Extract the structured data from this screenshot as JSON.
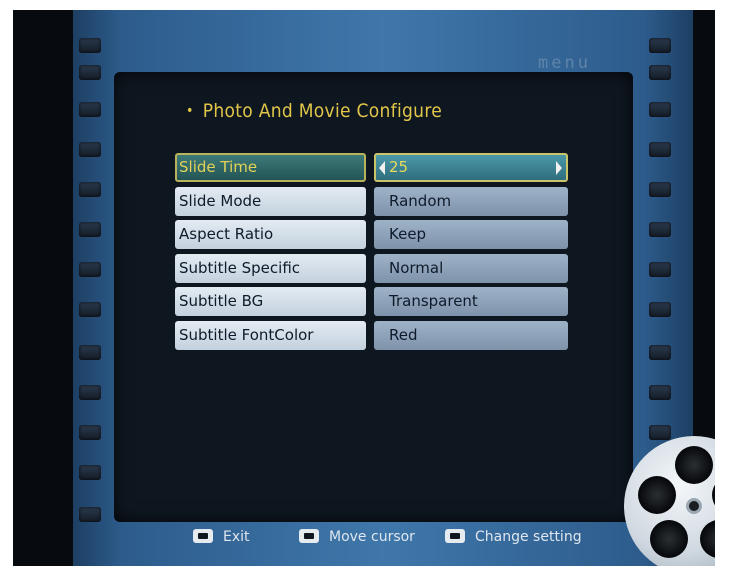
{
  "brand_text": "menu",
  "title": "Photo And Movie Configure",
  "settings": [
    {
      "label": "Slide Time",
      "value": "25",
      "selected": true
    },
    {
      "label": "Slide Mode",
      "value": "Random",
      "selected": false
    },
    {
      "label": "Aspect Ratio",
      "value": "Keep",
      "selected": false
    },
    {
      "label": "Subtitle Specific",
      "value": "Normal",
      "selected": false
    },
    {
      "label": "Subtitle BG",
      "value": "Transparent",
      "selected": false
    },
    {
      "label": "Subtitle FontColor",
      "value": "Red",
      "selected": false
    }
  ],
  "help": {
    "exit": {
      "icon": "enter-key-icon",
      "label": "Exit"
    },
    "move": {
      "icon": "up-down-key-icon",
      "label": "Move cursor"
    },
    "change": {
      "icon": "left-right-key-icon",
      "label": "Change setting"
    }
  },
  "colors": {
    "title": "#e1c64a",
    "selected_border": "#c9c36a",
    "film_strip": "#3f77aa"
  }
}
